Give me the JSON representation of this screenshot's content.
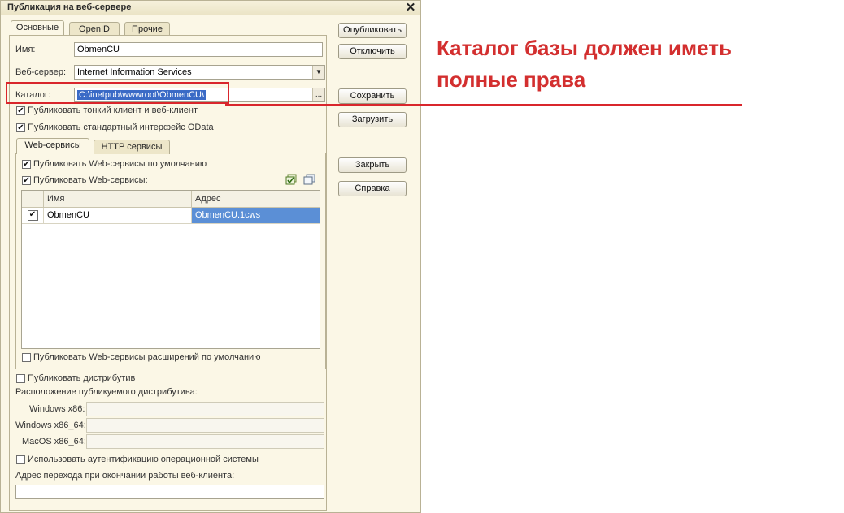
{
  "window": {
    "title": "Публикация на веб-сервере"
  },
  "tabs": [
    "Основные",
    "OpenID",
    "Прочие"
  ],
  "form": {
    "name_label": "Имя:",
    "name_value": "ObmenCU",
    "webserver_label": "Веб-сервер:",
    "webserver_value": "Internet Information Services",
    "catalog_label": "Каталог:",
    "catalog_value": "C:\\inetpub\\wwwroot\\ObmenCU\\",
    "catalog_button": "...",
    "publish_thin_client": "Публиковать тонкий клиент и веб-клиент",
    "publish_odata": "Публиковать стандартный интерфейс OData"
  },
  "inner_tabs": [
    "Web-сервисы",
    "HTTP сервисы"
  ],
  "webservices": {
    "publish_default": "Публиковать Web-сервисы по умолчанию",
    "publish_services": "Публиковать Web-сервисы:",
    "columns": [
      "Имя",
      "Адрес"
    ],
    "rows": [
      {
        "checked": true,
        "name": "ObmenCU",
        "address": "ObmenCU.1cws"
      }
    ],
    "publish_extensions": "Публиковать Web-сервисы расширений по умолчанию"
  },
  "distrib": {
    "publish_label": "Публиковать дистрибутив",
    "location_label": "Расположение публикуемого дистрибутива:",
    "win86": "Windows x86:",
    "win64": "Windows x86_64:",
    "macos": "MacOS x86_64:",
    "os_auth": "Использовать аутентификацию операционной системы",
    "exit_url_label": "Адрес перехода при окончании работы веб-клиента:"
  },
  "buttons": {
    "publish": "Опубликовать",
    "disable": "Отключить",
    "save": "Сохранить",
    "load": "Загрузить",
    "close": "Закрыть",
    "help": "Справка"
  },
  "annotation": {
    "line1": "Каталог базы должен иметь",
    "line2": "полные права"
  },
  "colors": {
    "annotation": "#d32f2f",
    "selection": "#3a6ac6",
    "row_highlight": "#5b8fd6"
  }
}
